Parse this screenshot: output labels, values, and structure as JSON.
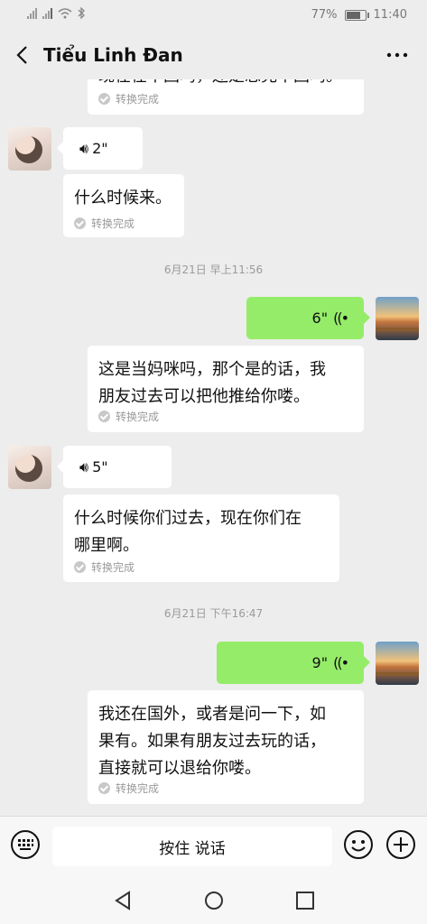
{
  "status": {
    "battery": "77%",
    "time": "11:40",
    "battery_level": 0.77
  },
  "header": {
    "title": "Tiểu Linh Đan"
  },
  "messages": {
    "top_partial": {
      "text": "现在在中国吗，还是忘完中国吗。",
      "status": "转换完成"
    },
    "voice1": {
      "duration": "2\""
    },
    "trans1": {
      "text": "什么时候来。",
      "status": "转换完成"
    },
    "time1": "6月21日 早上11:56",
    "voice2": {
      "duration": "6\""
    },
    "trans2": {
      "line1": "这是当妈咪吗，那个是的话，我",
      "line2": "朋友过去可以把他推给你喽。",
      "status": "转换完成"
    },
    "voice3": {
      "duration": "5\""
    },
    "trans3": {
      "line1": "什么时候你们过去，现在你们在",
      "line2": "哪里啊。",
      "status": "转换完成"
    },
    "time2": "6月21日 下午16:47",
    "voice4": {
      "duration": "9\""
    },
    "trans4": {
      "line1": "我还在国外，或者是问一下，如",
      "line2": "果有。如果有朋友过去玩的话，",
      "line3": "直接就可以退给你喽。",
      "status": "转换完成"
    }
  },
  "inputbar": {
    "hold_label": "按住 说话"
  },
  "colors": {
    "bubble_green": "#95ec69",
    "background": "#ededed"
  }
}
